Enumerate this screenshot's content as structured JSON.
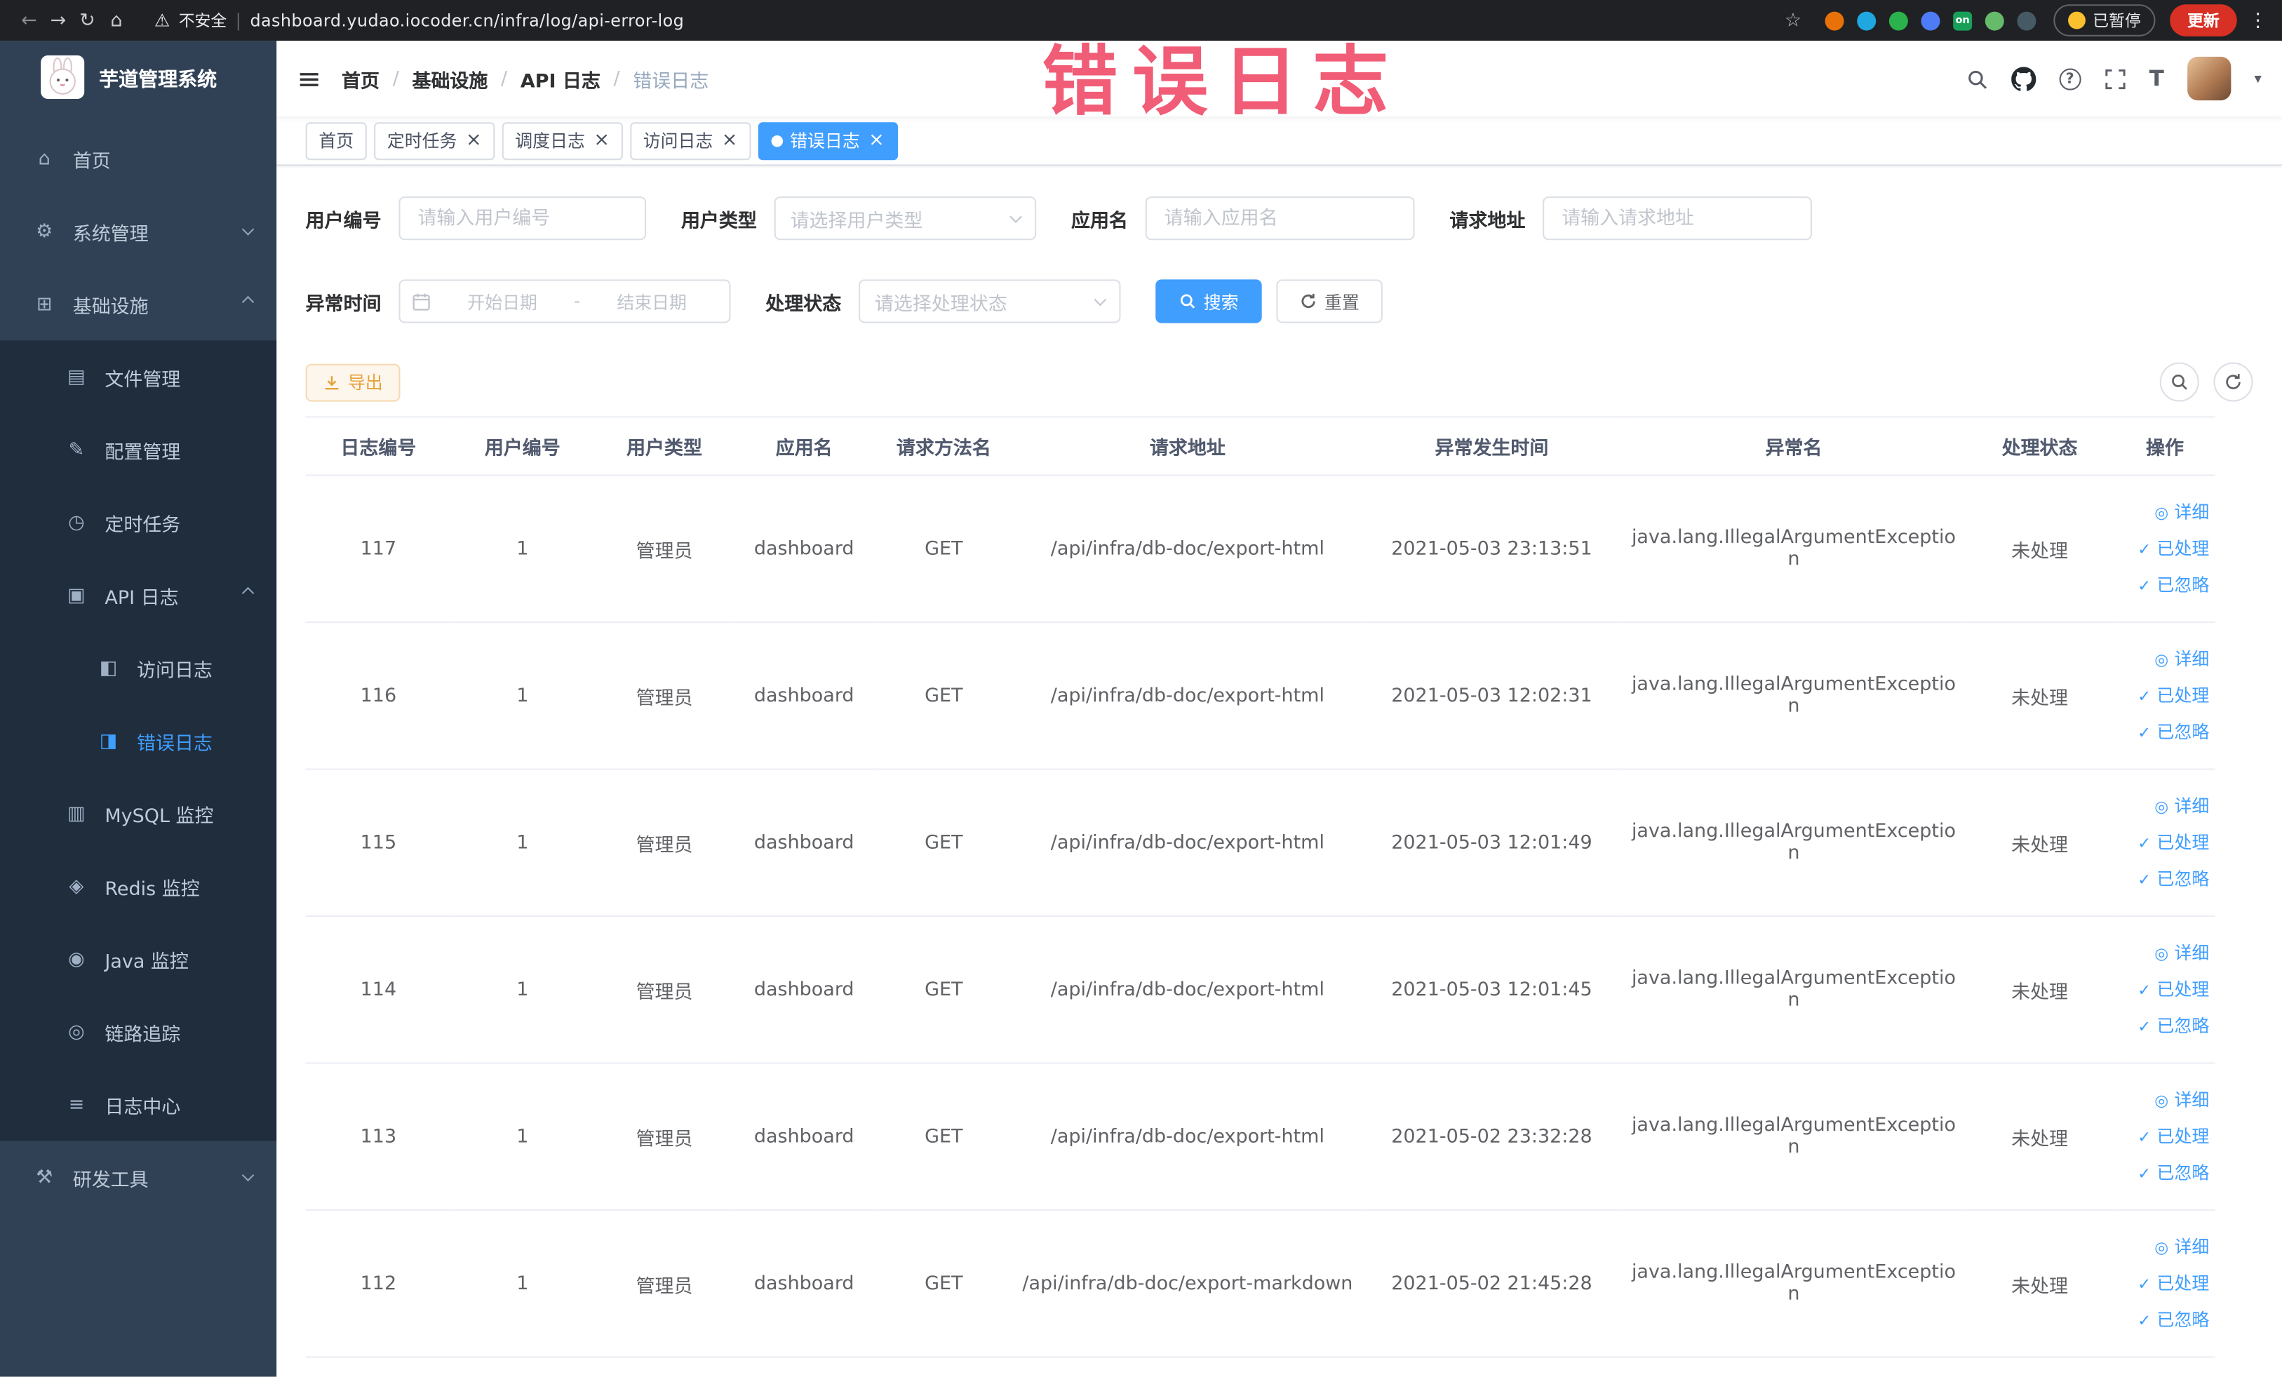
{
  "colors": {
    "accent": "#409eff",
    "watermark": "#ee3f5e",
    "warning": "#e6a23c",
    "update_red": "#d93025",
    "sidebar_bg": "#304156",
    "sidebar_submenu_bg": "#1f2d3d"
  },
  "icon_glyphs": {
    "home-icon": "⌂",
    "gear-icon": "⚙",
    "infra-icon": "⊞",
    "file-icon": "▤",
    "config-icon": "✎",
    "cron-icon": "◷",
    "api-log-icon": "▣",
    "access-log-icon": "◧",
    "error-log-icon": "◨",
    "mysql-icon": "▥",
    "redis-icon": "◈",
    "java-icon": "◉",
    "trace-icon": "◎",
    "log-center-icon": "≡",
    "tools-icon": "⚒",
    "view-icon": "◎",
    "check-icon": "✓",
    "hamburger-icon": "≡",
    "back-icon": "←",
    "forward-icon": "→",
    "reload-icon": "↻",
    "browser-home-icon": "⌂",
    "warning-icon": "⚠",
    "star-icon": "☆",
    "more-icon": "⋮",
    "caret-down-icon": "▾",
    "url-divider": "|",
    "help-icon": "?",
    "font-size-icon": "T"
  },
  "browser": {
    "security_label": "不安全",
    "url": "dashboard.yudao.iocoder.cn/infra/log/api-error-log",
    "paused_label": "已暂停",
    "update_label": "更新",
    "extensions": [
      {
        "name": "orange-circle",
        "color": "#e8710a"
      },
      {
        "name": "blue-drop",
        "color": "#1fa7e0"
      },
      {
        "name": "green-circle",
        "color": "#2bb24c"
      },
      {
        "name": "blue-grid",
        "color": "#4e7cf6"
      },
      {
        "name": "green-on-badge",
        "color": "#18a058",
        "label": "on"
      },
      {
        "name": "leaf",
        "color": "#66bb6a"
      },
      {
        "name": "dark-paw",
        "color": "#455a64"
      }
    ]
  },
  "sidebar": {
    "logo_title": "芋道管理系统",
    "items": [
      {
        "key": "home",
        "label": "首页",
        "level": 0,
        "icon": "home-icon"
      },
      {
        "key": "system-management",
        "label": "系统管理",
        "level": 0,
        "icon": "gear-icon",
        "arrow": "down"
      },
      {
        "key": "infrastructure",
        "label": "基础设施",
        "level": 0,
        "icon": "infra-icon",
        "arrow": "up"
      },
      {
        "key": "file-management",
        "label": "文件管理",
        "level": 1,
        "icon": "file-icon"
      },
      {
        "key": "config-management",
        "label": "配置管理",
        "level": 1,
        "icon": "config-icon"
      },
      {
        "key": "scheduled-tasks",
        "label": "定时任务",
        "level": 1,
        "icon": "cron-icon"
      },
      {
        "key": "api-log",
        "label": "API 日志",
        "level": 1,
        "icon": "api-log-icon",
        "arrow": "up"
      },
      {
        "key": "access-log",
        "label": "访问日志",
        "level": 2,
        "icon": "access-log-icon"
      },
      {
        "key": "error-log",
        "label": "错误日志",
        "level": 2,
        "icon": "error-log-icon",
        "active": true
      },
      {
        "key": "mysql-monitor",
        "label": "MySQL 监控",
        "level": 1,
        "icon": "mysql-icon"
      },
      {
        "key": "redis-monitor",
        "label": "Redis 监控",
        "level": 1,
        "icon": "redis-icon"
      },
      {
        "key": "java-monitor",
        "label": "Java 监控",
        "level": 1,
        "icon": "java-icon"
      },
      {
        "key": "trace",
        "label": "链路追踪",
        "level": 1,
        "icon": "trace-icon"
      },
      {
        "key": "log-center",
        "label": "日志中心",
        "level": 1,
        "icon": "log-center-icon"
      },
      {
        "key": "dev-tools",
        "label": "研发工具",
        "level": 0,
        "icon": "tools-icon",
        "arrow": "down"
      }
    ]
  },
  "header": {
    "breadcrumbs": [
      "首页",
      "基础设施",
      "API 日志",
      "错误日志"
    ],
    "watermark": "错误日志"
  },
  "tabs": [
    {
      "key": "home",
      "label": "首页",
      "closable": false,
      "active": false
    },
    {
      "key": "scheduled-tasks",
      "label": "定时任务",
      "closable": true,
      "active": false
    },
    {
      "key": "schedule-log",
      "label": "调度日志",
      "closable": true,
      "active": false
    },
    {
      "key": "access-log",
      "label": "访问日志",
      "closable": true,
      "active": false
    },
    {
      "key": "error-log",
      "label": "错误日志",
      "closable": true,
      "active": true
    }
  ],
  "filters": {
    "user_id_label": "用户编号",
    "user_id_placeholder": "请输入用户编号",
    "user_type_label": "用户类型",
    "user_type_placeholder": "请选择用户类型",
    "app_name_label": "应用名",
    "app_name_placeholder": "请输入应用名",
    "request_url_label": "请求地址",
    "request_url_placeholder": "请输入请求地址",
    "exception_time_label": "异常时间",
    "date_start_placeholder": "开始日期",
    "date_separator": "-",
    "date_end_placeholder": "结束日期",
    "process_status_label": "处理状态",
    "process_status_placeholder": "请选择处理状态",
    "search_button": "搜索",
    "reset_button": "重置"
  },
  "toolbar": {
    "export_label": "导出"
  },
  "table": {
    "columns": [
      {
        "key": "log-id",
        "label": "日志编号"
      },
      {
        "key": "user-id",
        "label": "用户编号"
      },
      {
        "key": "user-type",
        "label": "用户类型"
      },
      {
        "key": "app-name",
        "label": "应用名"
      },
      {
        "key": "method",
        "label": "请求方法名"
      },
      {
        "key": "request-url",
        "label": "请求地址"
      },
      {
        "key": "exception-time",
        "label": "异常发生时间"
      },
      {
        "key": "exception-name",
        "label": "异常名"
      },
      {
        "key": "process-status",
        "label": "处理状态"
      },
      {
        "key": "actions",
        "label": "操作"
      }
    ],
    "rows": [
      {
        "id": "117",
        "user_id": "1",
        "user_type": "管理员",
        "app": "dashboard",
        "method": "GET",
        "url": "/api/infra/db-doc/export-html",
        "time": "2021-05-03 23:13:51",
        "exception": "java.lang.IllegalArgumentException",
        "status": "未处理"
      },
      {
        "id": "116",
        "user_id": "1",
        "user_type": "管理员",
        "app": "dashboard",
        "method": "GET",
        "url": "/api/infra/db-doc/export-html",
        "time": "2021-05-03 12:02:31",
        "exception": "java.lang.IllegalArgumentException",
        "status": "未处理"
      },
      {
        "id": "115",
        "user_id": "1",
        "user_type": "管理员",
        "app": "dashboard",
        "method": "GET",
        "url": "/api/infra/db-doc/export-html",
        "time": "2021-05-03 12:01:49",
        "exception": "java.lang.IllegalArgumentException",
        "status": "未处理"
      },
      {
        "id": "114",
        "user_id": "1",
        "user_type": "管理员",
        "app": "dashboard",
        "method": "GET",
        "url": "/api/infra/db-doc/export-html",
        "time": "2021-05-03 12:01:45",
        "exception": "java.lang.IllegalArgumentException",
        "status": "未处理"
      },
      {
        "id": "113",
        "user_id": "1",
        "user_type": "管理员",
        "app": "dashboard",
        "method": "GET",
        "url": "/api/infra/db-doc/export-html",
        "time": "2021-05-02 23:32:28",
        "exception": "java.lang.IllegalArgumentException",
        "status": "未处理"
      },
      {
        "id": "112",
        "user_id": "1",
        "user_type": "管理员",
        "app": "dashboard",
        "method": "GET",
        "url": "/api/infra/db-doc/export-markdown",
        "time": "2021-05-02 21:45:28",
        "exception": "java.lang.IllegalArgumentException",
        "status": "未处理"
      }
    ],
    "row_actions": [
      {
        "key": "detail",
        "label": "详细",
        "icon": "view-icon"
      },
      {
        "key": "processed",
        "label": "已处理",
        "icon": "check-icon"
      },
      {
        "key": "ignored",
        "label": "已忽略",
        "icon": "check-icon"
      }
    ]
  }
}
